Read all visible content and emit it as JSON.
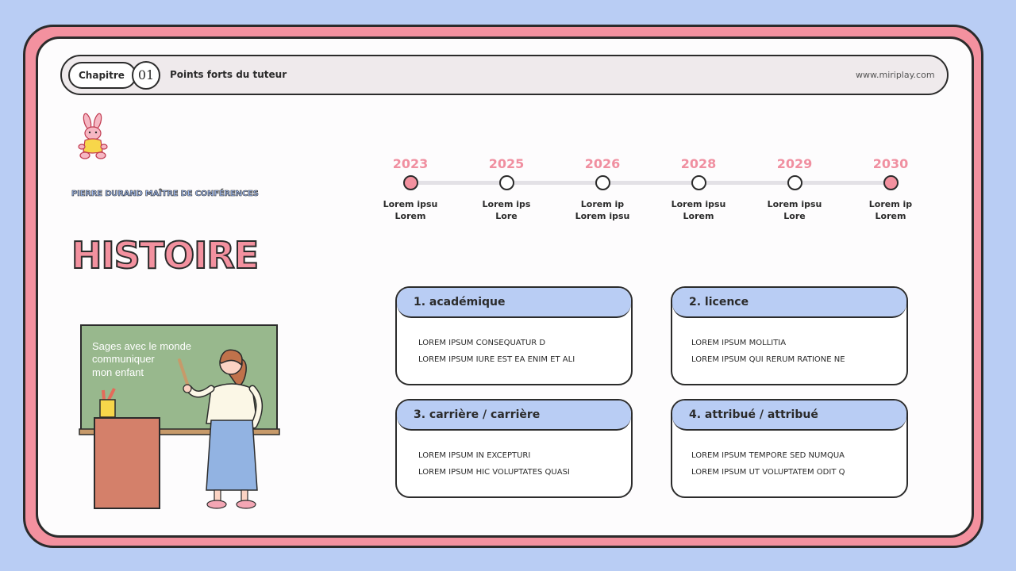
{
  "header": {
    "chapter_label": "Chapitre",
    "chapter_number": "01",
    "title": "Points forts du tuteur",
    "website": "www.miriplay.com"
  },
  "left": {
    "subtitle": "PIERRE DURAND MAÎTRE DE CONFÉRENCES",
    "title": "HISTOIRE",
    "chalkboard_text": [
      "Sages avec le monde",
      "communiquer",
      "mon enfant"
    ]
  },
  "timeline": [
    {
      "year": "2023",
      "line1": "Lorem ipsu",
      "line2": "Lorem",
      "filled": true
    },
    {
      "year": "2025",
      "line1": "Lorem ips",
      "line2": "Lore",
      "filled": false
    },
    {
      "year": "2026",
      "line1": "Lorem ip",
      "line2": "Lorem ipsu",
      "filled": false
    },
    {
      "year": "2028",
      "line1": "Lorem ipsu",
      "line2": "Lorem",
      "filled": false
    },
    {
      "year": "2029",
      "line1": "Lorem ipsu",
      "line2": "Lore",
      "filled": false
    },
    {
      "year": "2030",
      "line1": "Lorem ip",
      "line2": "Lorem",
      "filled": true
    }
  ],
  "boxes": [
    {
      "title": "1. académique",
      "lines": [
        "LOREM IPSUM CONSEQUATUR D",
        "LOREM IPSUM IURE EST EA ENIM ET ALI"
      ]
    },
    {
      "title": "2. licence",
      "lines": [
        "LOREM IPSUM MOLLITIA",
        "LOREM IPSUM QUI RERUM RATIONE NE"
      ]
    },
    {
      "title": "3. carrière / carrière",
      "lines": [
        "LOREM IPSUM IN EXCEPTURI",
        "LOREM IPSUM HIC VOLUPTATES QUASI"
      ]
    },
    {
      "title": "4. attribué / attribué",
      "lines": [
        "LOREM IPSUM TEMPORE SED NUMQUA",
        "LOREM IPSUM UT VOLUPTATEM ODIT Q"
      ]
    }
  ],
  "colors": {
    "background": "#b9cdf4",
    "pink": "#f3919f",
    "blue": "#b9cdf4",
    "outline": "#2b2b2b"
  }
}
